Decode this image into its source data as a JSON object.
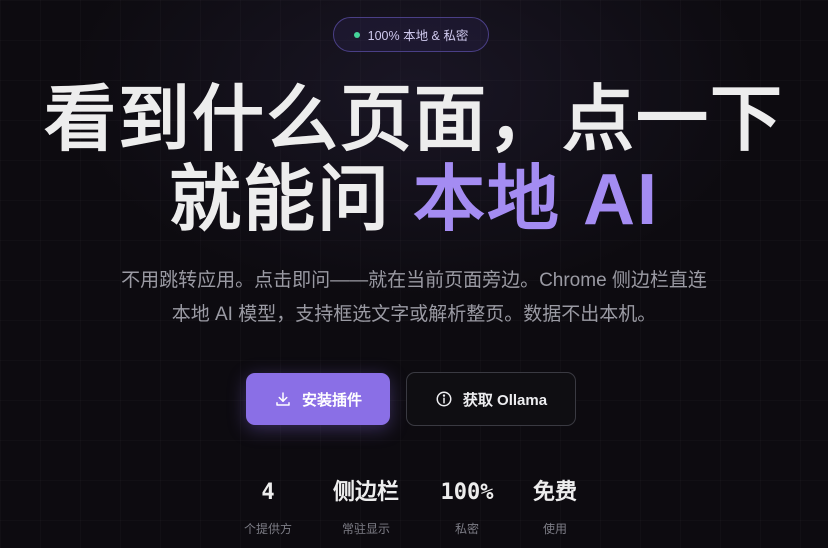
{
  "badge": {
    "text": "100% 本地 & 私密",
    "dot_color": "#45d39a"
  },
  "hero": {
    "title_line1": "看到什么页面，点一下",
    "title_line2_prefix": "就能问 ",
    "title_line2_accent": "本地 AI",
    "subtitle_line1": "不用跳转应用。点击即问——就在当前页面旁边。Chrome 侧边栏直连",
    "subtitle_line2": "本地 AI 模型，支持框选文字或解析整页。数据不出本机。"
  },
  "buttons": {
    "install": {
      "label": "安装插件",
      "icon": "download-icon"
    },
    "get_ollama": {
      "label": "获取 Ollama",
      "icon": "info-icon"
    }
  },
  "stats": [
    {
      "value": "4",
      "label": "个提供方"
    },
    {
      "value": "侧边栏",
      "label": "常驻显示"
    },
    {
      "value": "100%",
      "label": "私密"
    },
    {
      "value": "免费",
      "label": "使用"
    }
  ],
  "colors": {
    "accent": "#a48cf2",
    "primary_button": "#8a6fe6",
    "background": "#0d0b10"
  }
}
